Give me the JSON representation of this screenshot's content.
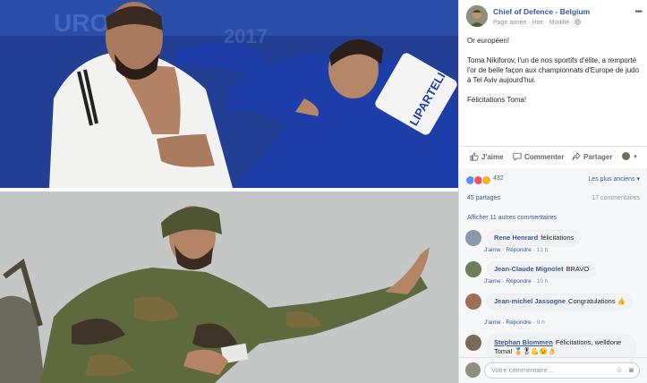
{
  "page": {
    "name": "Chief of Defence - Belgium",
    "meta": "Page aimée · Hier · Modifié · ",
    "more_icon": "ellipsis-icon"
  },
  "post": {
    "lines": [
      "Or européen!",
      "Toma Nikiforov, l'un de nos sportifs d'élite, a remporté l'or de belle façon aux championnats d'Europe de judo à Tel Aviv aujourd'hui.",
      "Félicitations Toma!"
    ]
  },
  "photo1": {
    "jersey_text": "LIPARTELIANI"
  },
  "actions": {
    "like": "J'aime",
    "comment": "Commenter",
    "share": "Partager"
  },
  "summary": {
    "reactions_count": "432",
    "sort_label": "Les plus anciens ▾",
    "shares": "45 partages",
    "comments": "17 commentaires",
    "reaction_colors": {
      "like": "#5890ff",
      "love": "#f25268",
      "wow": "#f7b125"
    }
  },
  "comments": {
    "show_more": "Afficher 11 autres commentaires",
    "like_label": "J'aime",
    "reply_label": "Répondre",
    "items": [
      {
        "author": "Rene Henrard",
        "text": "félicitations",
        "time": "13 h"
      },
      {
        "author": "Jean-Claude Mignolet",
        "text": "BRAVO",
        "time": "10 h"
      },
      {
        "author": "Jean-michel Jassogne",
        "text": "Congratulations 👍",
        "time": "9 h"
      },
      {
        "author": "Stephan Blommen",
        "text": "Félicitations, welldone Toma! 🏅🎖💪😉👌",
        "time": ""
      }
    ],
    "placeholder": "Votre commentaire..."
  }
}
